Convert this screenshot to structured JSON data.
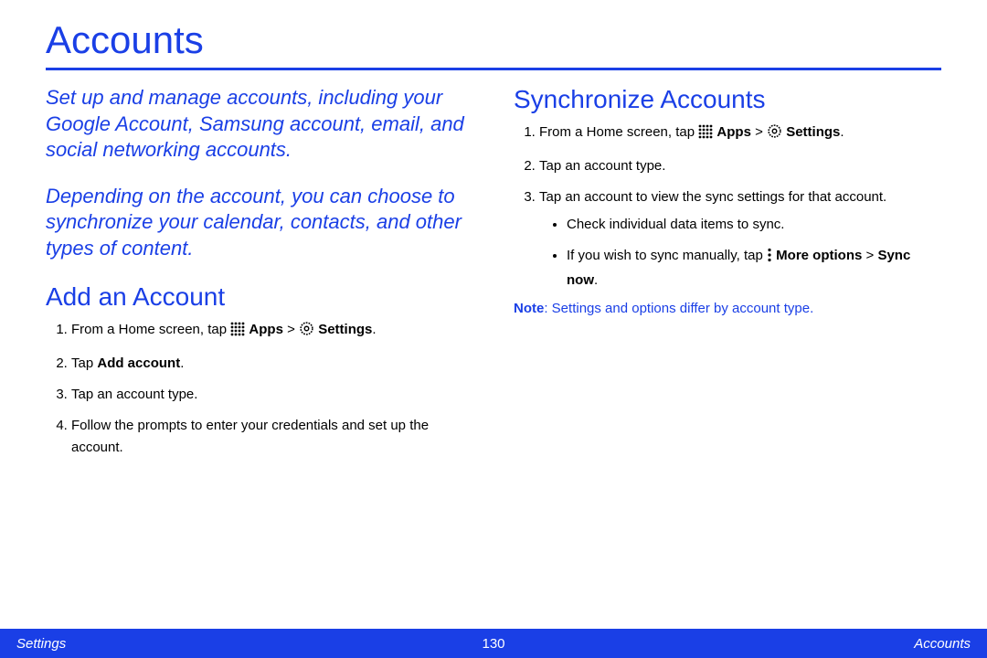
{
  "page": {
    "title": "Accounts",
    "intro1": "Set up and manage accounts, including your Google Account, Samsung account, email, and social networking accounts.",
    "intro2": "Depending on the account, you can choose to synchronize your calendar, contacts, and other types of content."
  },
  "add": {
    "heading": "Add an Account",
    "step1_pre": "From a Home screen, tap ",
    "step1_apps": "Apps",
    "step1_gt": " > ",
    "step1_settings": "Settings",
    "step1_end": ".",
    "step2_pre": "Tap ",
    "step2_bold": "Add account",
    "step2_end": ".",
    "step3": "Tap an account type.",
    "step4": "Follow the prompts to enter your credentials and set up the account."
  },
  "sync": {
    "heading": "Synchronize Accounts",
    "step1_pre": "From a Home screen, tap ",
    "step1_apps": "Apps",
    "step1_gt": " > ",
    "step1_settings": "Settings",
    "step1_end": ".",
    "step2": "Tap an account type.",
    "step3": "Tap an account to view the sync settings for that account.",
    "sub1": "Check individual data items to sync.",
    "sub2_pre": "If you wish to sync manually, tap ",
    "sub2_more": "More options",
    "sub2_gt": " > ",
    "sub2_sync": "Sync now",
    "sub2_end": ".",
    "note_label": "Note",
    "note_text": ": Settings and options differ by account type."
  },
  "footer": {
    "left": "Settings",
    "center": "130",
    "right": "Accounts"
  }
}
